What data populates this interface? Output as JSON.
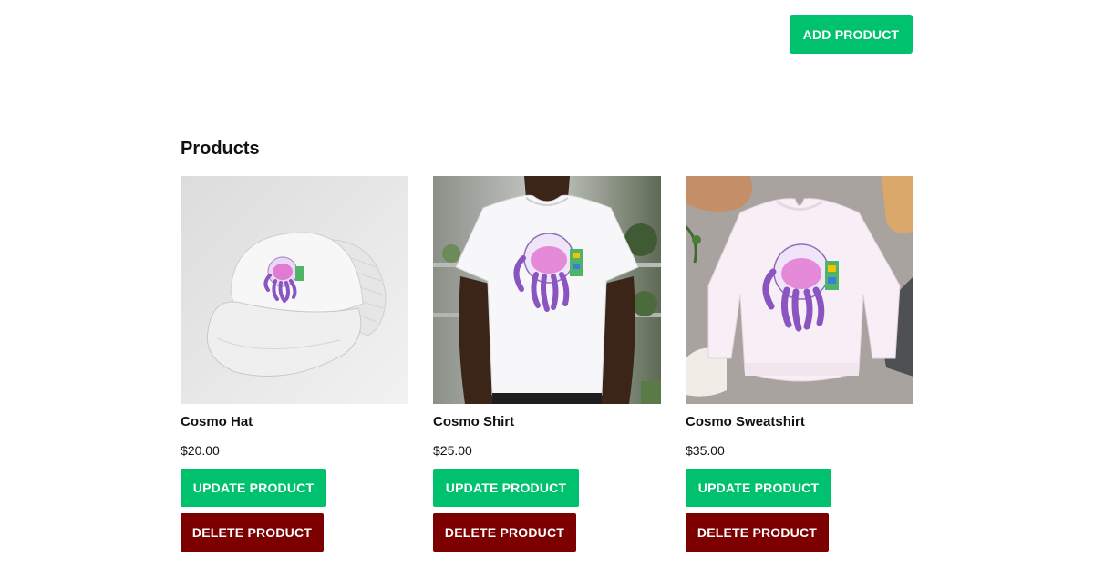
{
  "toolbar": {
    "add_label": "ADD PRODUCT"
  },
  "section": {
    "title": "Products"
  },
  "colors": {
    "accent_green": "#00c16e",
    "danger_red": "#7d0000"
  },
  "products": [
    {
      "name": "Cosmo Hat",
      "price": "$20.00",
      "image": "hat-with-jellyfish-astronaut-image",
      "update_label": "UPDATE PRODUCT",
      "delete_label": "DELETE PRODUCT"
    },
    {
      "name": "Cosmo Shirt",
      "price": "$25.00",
      "image": "shirt-with-jellyfish-astronaut-image",
      "update_label": "UPDATE PRODUCT",
      "delete_label": "DELETE PRODUCT"
    },
    {
      "name": "Cosmo Sweatshirt",
      "price": "$35.00",
      "image": "sweatshirt-with-jellyfish-astronaut-image",
      "update_label": "UPDATE PRODUCT",
      "delete_label": "DELETE PRODUCT"
    }
  ]
}
